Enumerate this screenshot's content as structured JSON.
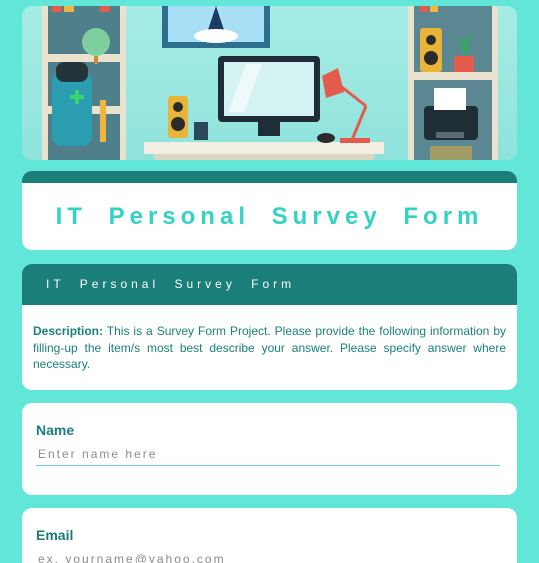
{
  "banner": {
    "illustration": "workspace-desk-illustration"
  },
  "title": "IT Personal Survey Form",
  "form_header": "IT Personal Survey Form",
  "description": {
    "label": "Description:",
    "text": " This is a Survey Form Project. Please provide the following information by filling-up the item/s most best describe your answer. Please specify answer where necessary."
  },
  "fields": {
    "name": {
      "label": "Name",
      "placeholder": "Enter name here",
      "value": ""
    },
    "email": {
      "label": "Email",
      "placeholder": "ex. yourname@yahoo.com",
      "value": ""
    }
  },
  "colors": {
    "background": "#62e6d8",
    "primary": "#1a7f79",
    "accent": "#33d3c4",
    "card": "#ffffff"
  }
}
